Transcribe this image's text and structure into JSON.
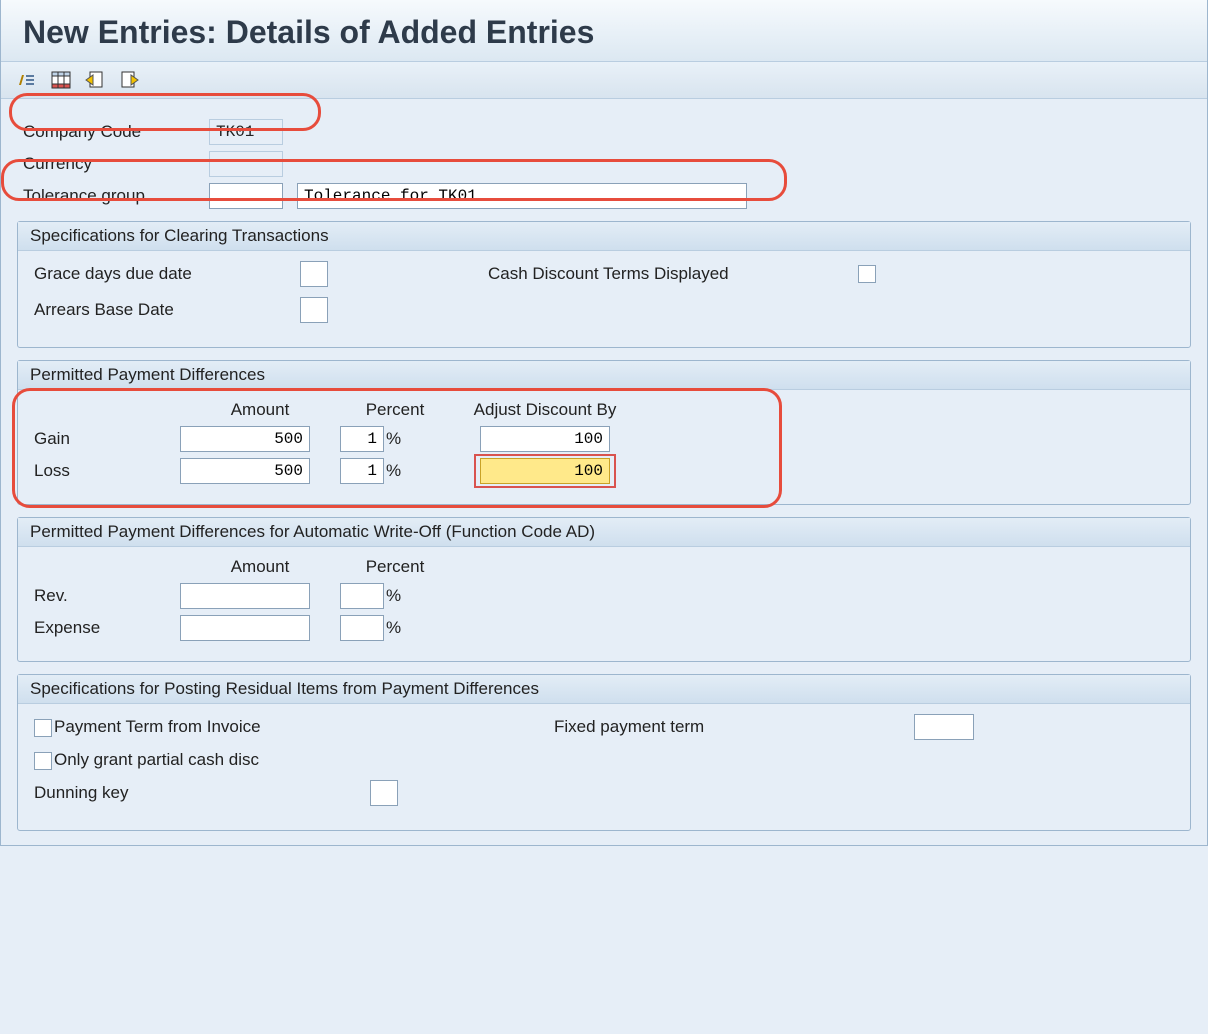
{
  "title": "New Entries: Details of Added Entries",
  "toolbar_icons": [
    "toggle-icon",
    "table-settings-icon",
    "prev-entry-icon",
    "next-entry-icon"
  ],
  "header": {
    "company_code_label": "Company Code",
    "company_code_value": "TK01",
    "currency_label": "Currency",
    "currency_value": "",
    "tolerance_group_label": "Tolerance group",
    "tolerance_group_code": "",
    "tolerance_group_desc": "Tolerance for TK01"
  },
  "group_clearing": {
    "title": "Specifications for Clearing Transactions",
    "grace_days_label": "Grace days due date",
    "grace_days_value": "",
    "cash_discount_label": "Cash Discount Terms Displayed",
    "arrears_label": "Arrears Base Date",
    "arrears_value": ""
  },
  "group_diff": {
    "title": "Permitted Payment Differences",
    "col_amount": "Amount",
    "col_percent": "Percent",
    "col_adjust": "Adjust Discount By",
    "gain_label": "Gain",
    "gain_amount": "500",
    "gain_percent": "1",
    "gain_adjust": "100",
    "loss_label": "Loss",
    "loss_amount": "500",
    "loss_percent": "1",
    "loss_adjust": "100",
    "pct_sign": "%"
  },
  "group_auto": {
    "title": "Permitted Payment Differences for Automatic Write-Off (Function Code AD)",
    "col_amount": "Amount",
    "col_percent": "Percent",
    "rev_label": "Rev.",
    "rev_amount": "",
    "rev_percent": "",
    "exp_label": "Expense",
    "exp_amount": "",
    "exp_percent": "",
    "pct_sign": "%"
  },
  "group_resid": {
    "title": "Specifications for Posting Residual Items from Payment Differences",
    "payment_term_label": "Payment Term from Invoice",
    "fixed_term_label": "Fixed payment term",
    "fixed_term_value": "",
    "partial_disc_label": "Only grant partial cash disc",
    "dunning_label": "Dunning key",
    "dunning_value": ""
  }
}
